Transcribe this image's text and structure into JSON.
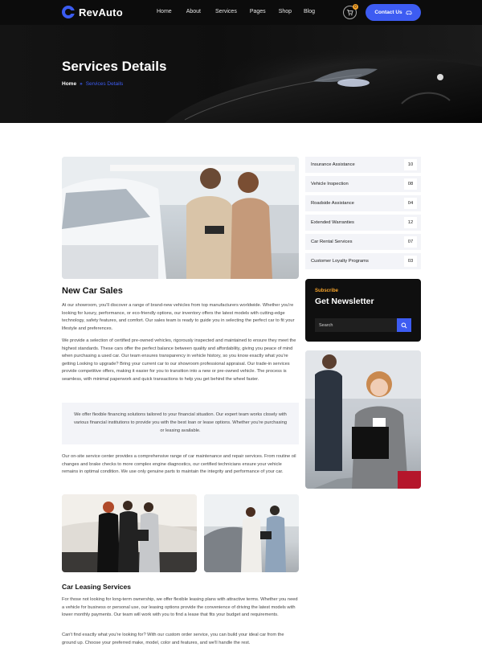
{
  "brand": {
    "name": "RevAuto"
  },
  "nav": {
    "items": [
      "Home",
      "About",
      "Services",
      "Pages",
      "Shop",
      "Blog"
    ],
    "cart_count": "0",
    "contact_label": "Contact Us"
  },
  "hero": {
    "title": "Services Details",
    "breadcrumb_home": "Home",
    "breadcrumb_sep": "»",
    "breadcrumb_current": "Services Details"
  },
  "main": {
    "title": "New Car Sales",
    "para1": "At our showroom, you'll discover a range of brand-new vehicles from top manufacturers worldwide. Whether you're looking for luxury, performance, or eco-friendly options, our inventory offers the latest models with cutting-edge technology, safety features, and comfort. Our sales team is ready to guide you in selecting the perfect car to fit your lifestyle and preferences.",
    "para2": "We provide a selection of certified pre-owned vehicles, rigorously inspected and maintained to ensure they meet the highest standards. These cars offer the perfect balance between quality and affordability, giving you peace of mind when purchasing a used car. Our team ensures transparency in vehicle history, so you know exactly what you're getting Looking to upgrade? Bring your current car to our showroom professional appraisal. Our trade-in services provide competitive offers, making it easier for you to transition into a new or pre-owned vehicle. The process is seamless, with minimal paperwork and quick transactions to help you get behind the wheel faster.",
    "quote": "We offer flexible financing solutions tailored to your financial situation. Our expert team works closely with various financial institutions to provide you with the best loan or lease options. Whether you're purchasing or leasing available.",
    "para3": "Our on-site service center provides a comprehensive range of car maintenance and repair services. From routine oil changes and brake checks to more complex engine diagnostics, our certified technicians ensure your vehicle remains in optimal condition. We use only genuine parts to maintain the integrity and performance of your car.",
    "leasing_title": "Car Leasing Services",
    "para4": "For those not looking for long-term ownership, we offer flexible leasing plans with attractive terms. Whether you need a vehicle for business or personal use, our leasing options provide the convenience of driving the latest models with lower monthly payments. Our team will work with you to find a lease that fits your budget and requirements.",
    "para5": "Can't find exactly what you're looking for? With our custom order service, you can build your ideal car from the ground up. Choose your preferred make, model, color and features, and we'll handle the rest."
  },
  "sidebar": {
    "services": [
      {
        "label": "Insurance Assistance",
        "count": "10"
      },
      {
        "label": "Vehicle Inspection",
        "count": "08"
      },
      {
        "label": "Roadside Assistance",
        "count": "04"
      },
      {
        "label": "Extended Warranties",
        "count": "12"
      },
      {
        "label": "Car Rental Services",
        "count": "07"
      },
      {
        "label": "Customer Loyalty Programs",
        "count": "03"
      }
    ],
    "newsletter": {
      "subtitle": "Subscribe",
      "title": "Get Newsletter",
      "placeholder": "Search"
    }
  },
  "colors": {
    "accent": "#3d5cf2",
    "highlight": "#f7a42a",
    "dark": "#0f0f0f",
    "panel": "#f3f4f8"
  }
}
